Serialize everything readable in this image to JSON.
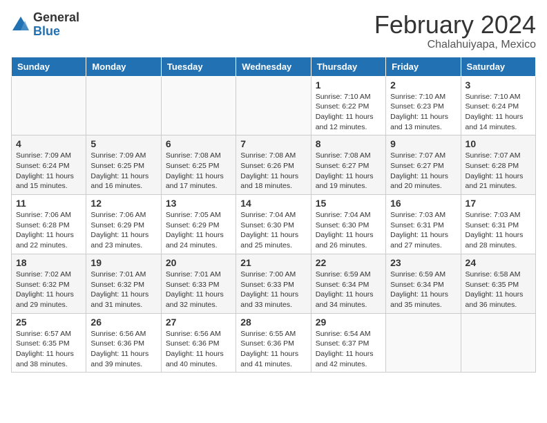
{
  "header": {
    "logo_general": "General",
    "logo_blue": "Blue",
    "month_title": "February 2024",
    "location": "Chalahuiyapa, Mexico"
  },
  "weekdays": [
    "Sunday",
    "Monday",
    "Tuesday",
    "Wednesday",
    "Thursday",
    "Friday",
    "Saturday"
  ],
  "weeks": [
    [
      {
        "day": "",
        "info": ""
      },
      {
        "day": "",
        "info": ""
      },
      {
        "day": "",
        "info": ""
      },
      {
        "day": "",
        "info": ""
      },
      {
        "day": "1",
        "info": "Sunrise: 7:10 AM\nSunset: 6:22 PM\nDaylight: 11 hours\nand 12 minutes."
      },
      {
        "day": "2",
        "info": "Sunrise: 7:10 AM\nSunset: 6:23 PM\nDaylight: 11 hours\nand 13 minutes."
      },
      {
        "day": "3",
        "info": "Sunrise: 7:10 AM\nSunset: 6:24 PM\nDaylight: 11 hours\nand 14 minutes."
      }
    ],
    [
      {
        "day": "4",
        "info": "Sunrise: 7:09 AM\nSunset: 6:24 PM\nDaylight: 11 hours\nand 15 minutes."
      },
      {
        "day": "5",
        "info": "Sunrise: 7:09 AM\nSunset: 6:25 PM\nDaylight: 11 hours\nand 16 minutes."
      },
      {
        "day": "6",
        "info": "Sunrise: 7:08 AM\nSunset: 6:25 PM\nDaylight: 11 hours\nand 17 minutes."
      },
      {
        "day": "7",
        "info": "Sunrise: 7:08 AM\nSunset: 6:26 PM\nDaylight: 11 hours\nand 18 minutes."
      },
      {
        "day": "8",
        "info": "Sunrise: 7:08 AM\nSunset: 6:27 PM\nDaylight: 11 hours\nand 19 minutes."
      },
      {
        "day": "9",
        "info": "Sunrise: 7:07 AM\nSunset: 6:27 PM\nDaylight: 11 hours\nand 20 minutes."
      },
      {
        "day": "10",
        "info": "Sunrise: 7:07 AM\nSunset: 6:28 PM\nDaylight: 11 hours\nand 21 minutes."
      }
    ],
    [
      {
        "day": "11",
        "info": "Sunrise: 7:06 AM\nSunset: 6:28 PM\nDaylight: 11 hours\nand 22 minutes."
      },
      {
        "day": "12",
        "info": "Sunrise: 7:06 AM\nSunset: 6:29 PM\nDaylight: 11 hours\nand 23 minutes."
      },
      {
        "day": "13",
        "info": "Sunrise: 7:05 AM\nSunset: 6:29 PM\nDaylight: 11 hours\nand 24 minutes."
      },
      {
        "day": "14",
        "info": "Sunrise: 7:04 AM\nSunset: 6:30 PM\nDaylight: 11 hours\nand 25 minutes."
      },
      {
        "day": "15",
        "info": "Sunrise: 7:04 AM\nSunset: 6:30 PM\nDaylight: 11 hours\nand 26 minutes."
      },
      {
        "day": "16",
        "info": "Sunrise: 7:03 AM\nSunset: 6:31 PM\nDaylight: 11 hours\nand 27 minutes."
      },
      {
        "day": "17",
        "info": "Sunrise: 7:03 AM\nSunset: 6:31 PM\nDaylight: 11 hours\nand 28 minutes."
      }
    ],
    [
      {
        "day": "18",
        "info": "Sunrise: 7:02 AM\nSunset: 6:32 PM\nDaylight: 11 hours\nand 29 minutes."
      },
      {
        "day": "19",
        "info": "Sunrise: 7:01 AM\nSunset: 6:32 PM\nDaylight: 11 hours\nand 31 minutes."
      },
      {
        "day": "20",
        "info": "Sunrise: 7:01 AM\nSunset: 6:33 PM\nDaylight: 11 hours\nand 32 minutes."
      },
      {
        "day": "21",
        "info": "Sunrise: 7:00 AM\nSunset: 6:33 PM\nDaylight: 11 hours\nand 33 minutes."
      },
      {
        "day": "22",
        "info": "Sunrise: 6:59 AM\nSunset: 6:34 PM\nDaylight: 11 hours\nand 34 minutes."
      },
      {
        "day": "23",
        "info": "Sunrise: 6:59 AM\nSunset: 6:34 PM\nDaylight: 11 hours\nand 35 minutes."
      },
      {
        "day": "24",
        "info": "Sunrise: 6:58 AM\nSunset: 6:35 PM\nDaylight: 11 hours\nand 36 minutes."
      }
    ],
    [
      {
        "day": "25",
        "info": "Sunrise: 6:57 AM\nSunset: 6:35 PM\nDaylight: 11 hours\nand 38 minutes."
      },
      {
        "day": "26",
        "info": "Sunrise: 6:56 AM\nSunset: 6:36 PM\nDaylight: 11 hours\nand 39 minutes."
      },
      {
        "day": "27",
        "info": "Sunrise: 6:56 AM\nSunset: 6:36 PM\nDaylight: 11 hours\nand 40 minutes."
      },
      {
        "day": "28",
        "info": "Sunrise: 6:55 AM\nSunset: 6:36 PM\nDaylight: 11 hours\nand 41 minutes."
      },
      {
        "day": "29",
        "info": "Sunrise: 6:54 AM\nSunset: 6:37 PM\nDaylight: 11 hours\nand 42 minutes."
      },
      {
        "day": "",
        "info": ""
      },
      {
        "day": "",
        "info": ""
      }
    ]
  ]
}
